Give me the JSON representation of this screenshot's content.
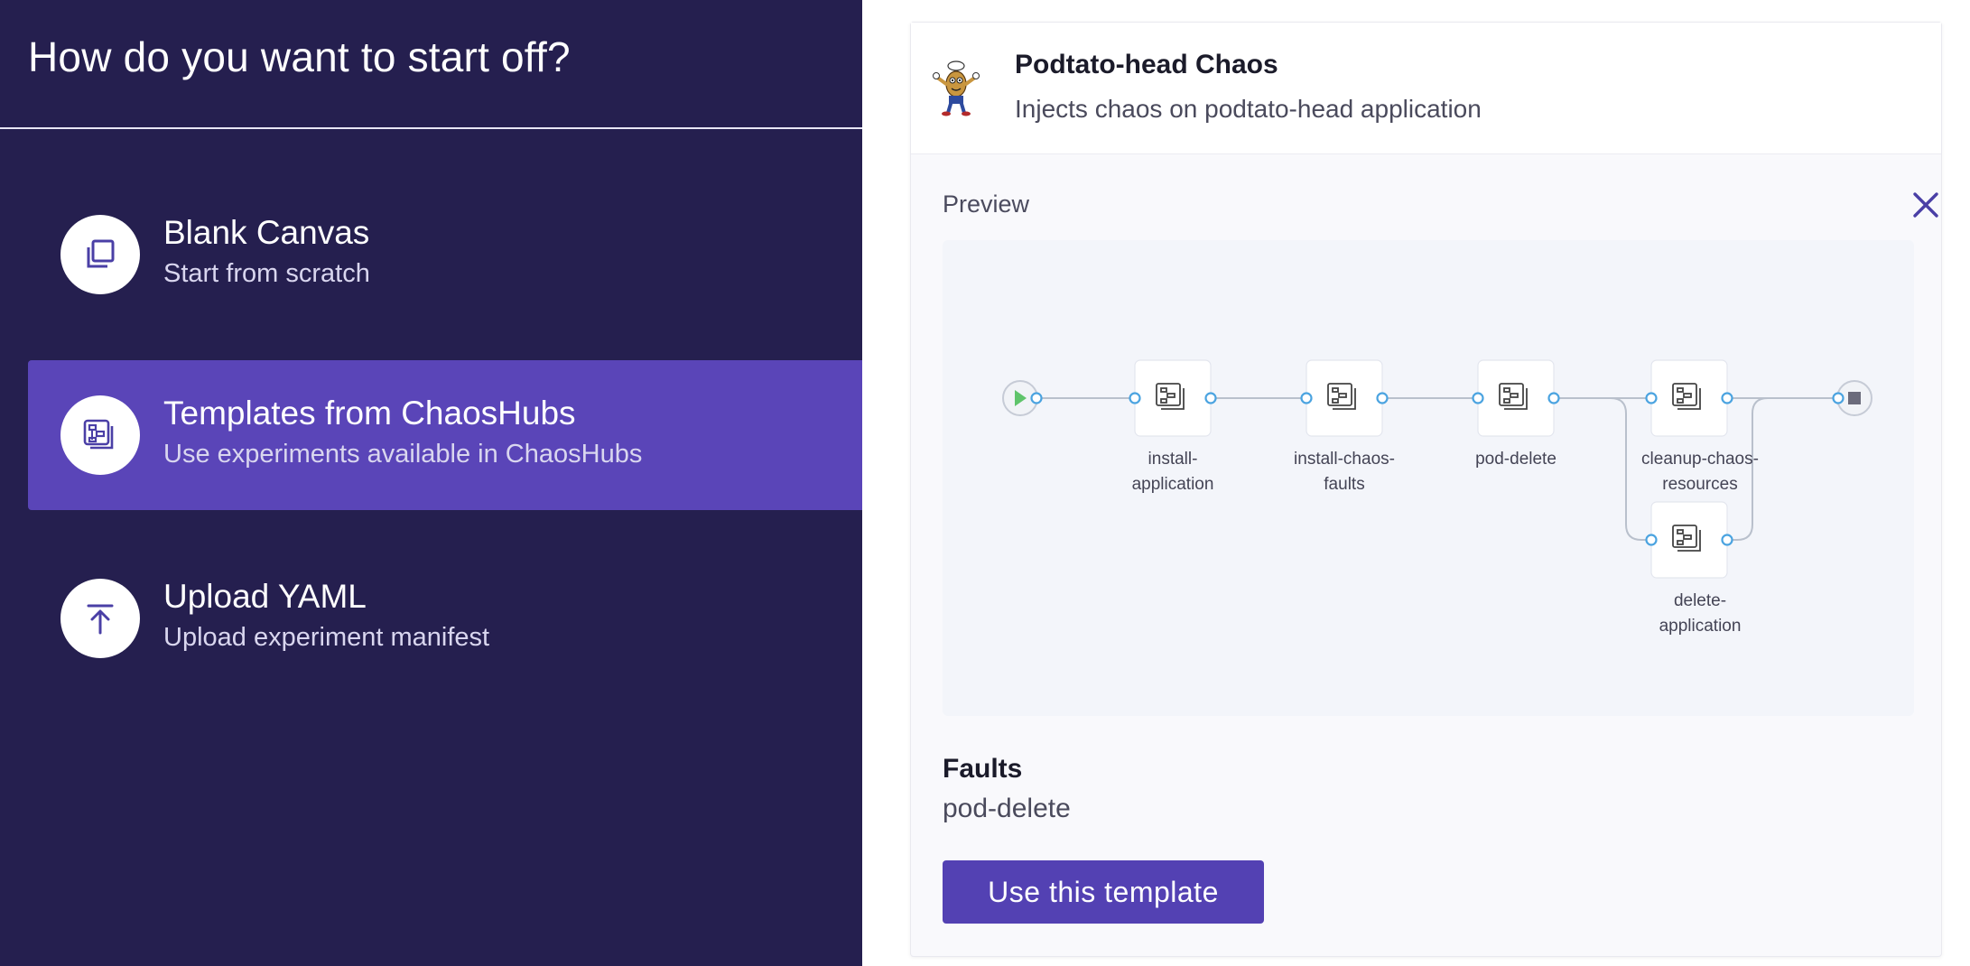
{
  "left": {
    "title": "How do you want to start off?",
    "options": [
      {
        "title": "Blank Canvas",
        "subtitle": "Start from scratch",
        "icon": "copy-icon",
        "selected": false
      },
      {
        "title": "Templates from ChaosHubs",
        "subtitle": "Use experiments available in ChaosHubs",
        "icon": "templates-icon",
        "selected": true
      },
      {
        "title": "Upload YAML",
        "subtitle": "Upload experiment manifest",
        "icon": "upload-icon",
        "selected": false
      }
    ]
  },
  "template": {
    "title": "Podtato-head Chaos",
    "description": "Injects chaos on podtato-head application",
    "logo": "podtato-head-mascot-icon",
    "preview_label": "Preview",
    "close_icon": "close-icon",
    "faults_label": "Faults",
    "faults_value": "pod-delete",
    "use_button": "Use this template"
  },
  "workflow": {
    "nodes": [
      {
        "label_lines": [
          "install-",
          "application"
        ]
      },
      {
        "label_lines": [
          "install-chaos-",
          "faults"
        ]
      },
      {
        "label_lines": [
          "pod-delete"
        ]
      },
      {
        "label_lines": [
          "cleanup-chaos-",
          "resources"
        ]
      },
      {
        "label_lines": [
          "delete-",
          "application"
        ]
      }
    ]
  },
  "colors": {
    "left_bg": "#251f4f",
    "selected_bg": "#5a45b8",
    "accent": "#5341b3",
    "connector": "#4aa3e0",
    "start_green": "#5fc46b"
  }
}
